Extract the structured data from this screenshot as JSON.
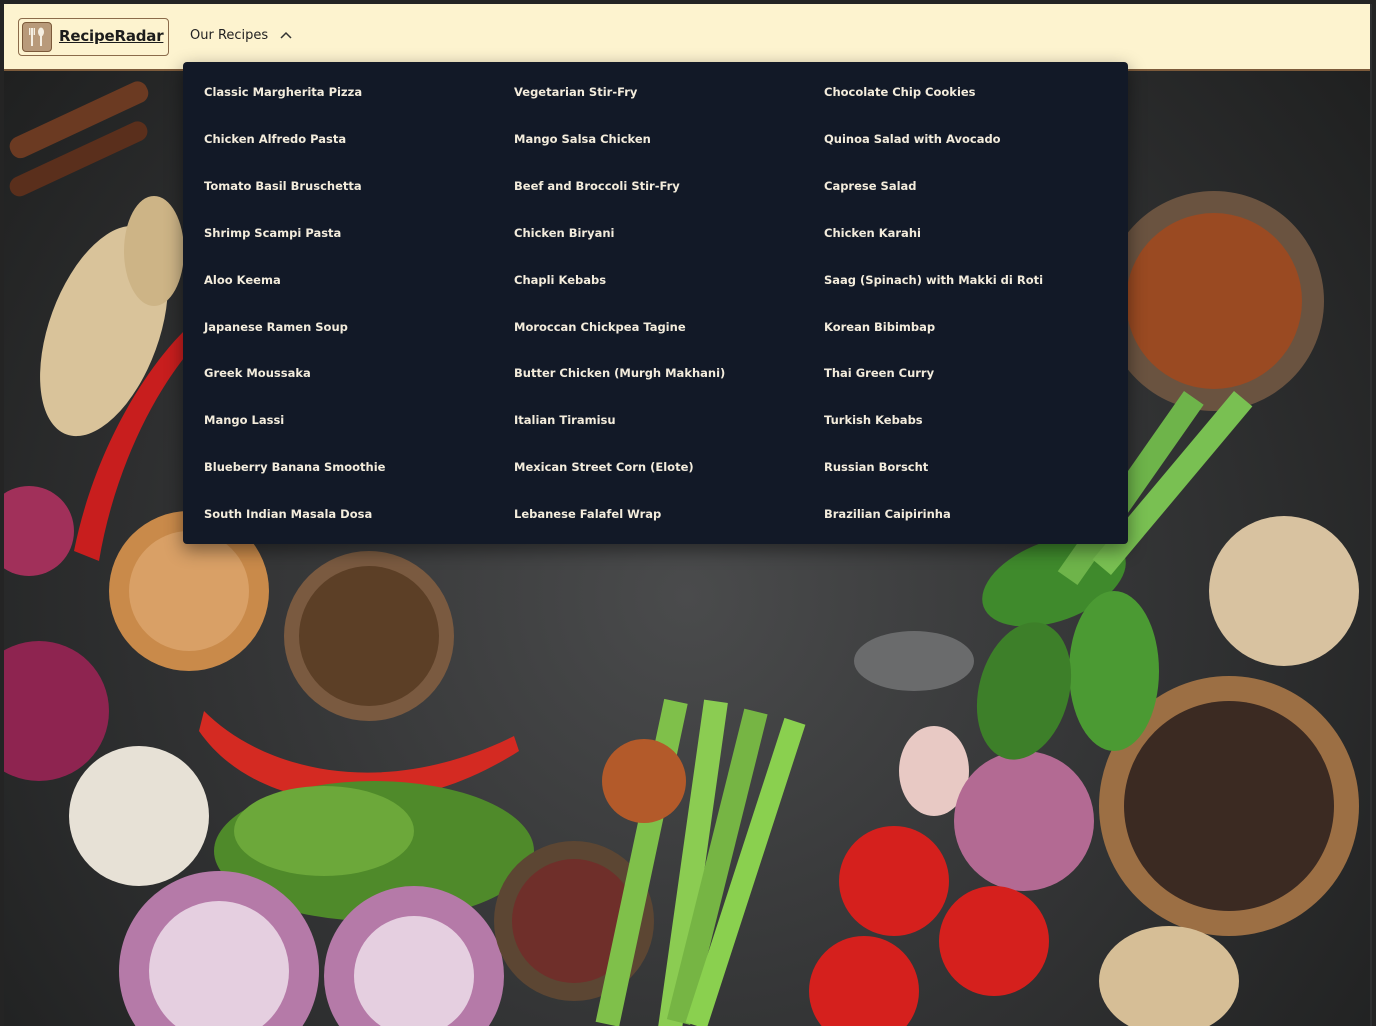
{
  "navbar": {
    "brand_name": "RecipeRadar",
    "logo_icon": "utensils-icon",
    "recipes_menu_label": "Our Recipes",
    "recipes_menu_icon": "chevron-up-icon"
  },
  "recipes_menu": {
    "columns": [
      [
        "Classic Margherita Pizza",
        "Chicken Alfredo Pasta",
        "Tomato Basil Bruschetta",
        "Shrimp Scampi Pasta",
        "Aloo Keema",
        "Japanese Ramen Soup",
        "Greek Moussaka",
        "Mango Lassi",
        "Blueberry Banana Smoothie",
        "South Indian Masala Dosa"
      ],
      [
        "Vegetarian Stir-Fry",
        "Mango Salsa Chicken",
        "Beef and Broccoli Stir-Fry",
        "Chicken Biryani",
        "Chapli Kebabs",
        "Moroccan Chickpea Tagine",
        "Butter Chicken (Murgh Makhani)",
        "Italian Tiramisu",
        "Mexican Street Corn (Elote)",
        "Lebanese Falafel Wrap"
      ],
      [
        "Chocolate Chip Cookies",
        "Quinoa Salad with Avocado",
        "Caprese Salad",
        "Chicken Karahi",
        "Saag (Spinach) with Makki di Roti",
        "Korean Bibimbap",
        "Thai Green Curry",
        "Turkish Kebabs",
        "Russian Borscht",
        "Brazilian Caipirinha"
      ]
    ]
  },
  "colors": {
    "navbar_bg": "#fdf3cf",
    "menu_bg": "#121927",
    "menu_text": "#f3ecdc"
  }
}
